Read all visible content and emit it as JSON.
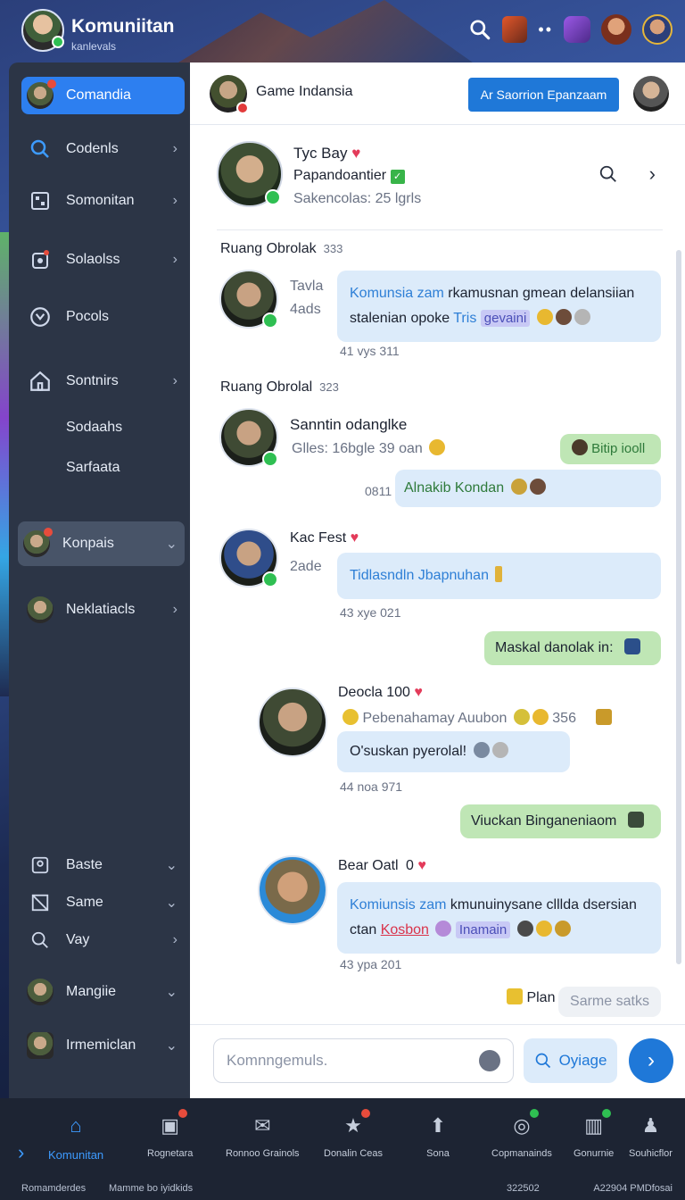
{
  "top": {
    "title": "Komuniitan",
    "subtitle": "kanlevals"
  },
  "sidebar": {
    "items": [
      {
        "label": "Comandia"
      },
      {
        "label": "Codenls"
      },
      {
        "label": "Somonitan"
      },
      {
        "label": "Solaolss"
      },
      {
        "label": "Pocols"
      },
      {
        "label": "Sontnirs"
      },
      {
        "label": "Sodaahs"
      },
      {
        "label": "Sarfaata"
      },
      {
        "label": "Konpais"
      },
      {
        "label": "Neklatiacls"
      },
      {
        "label": "Baste"
      },
      {
        "label": "Same"
      },
      {
        "label": "Vay"
      },
      {
        "label": "Mangiie"
      },
      {
        "label": "Irmemiclan"
      }
    ]
  },
  "header": {
    "title": "Game Indansia",
    "button": "Ar Saorrion Epanzaam"
  },
  "profile": {
    "name": "Tyc Bay",
    "line2": "Papandoantier",
    "line3": "Sakencolas: 25 lgrls"
  },
  "feed": {
    "section1": {
      "title": "Ruang Obrolak",
      "count": "333"
    },
    "msg1": {
      "side_top": "Tavla",
      "side_bottom": "4ads",
      "text_blue": "Komunsia zam",
      "text_rest": " rkamusnan gmean delansiian stalenian opoke ",
      "text_tris": "Tris",
      "tag": "gevaini",
      "time": "41 vys 311"
    },
    "section2": {
      "title": "Ruang Obrolal",
      "count": "323"
    },
    "msg2": {
      "name": "Sanntin odanglke",
      "line2": "Glles: 16bgle 39 oan",
      "green_chip": "Bitip iooll",
      "time_label": "0811",
      "bubble": "Alnakib Kondan"
    },
    "msg3": {
      "name": "Kac Fest",
      "sub": "2ade",
      "bubble": "Tidlasndln Jbapnuhan",
      "time": "43 xye 021",
      "reply": "Maskal danolak in:"
    },
    "msg4": {
      "name": "Deocla 100",
      "line2": "Pebenahamay Auubon",
      "count": "356",
      "bubble": "O'suskan pyerolal!",
      "time": "44 noa 971",
      "reply": "Viuckan Binganeniaom"
    },
    "msg5": {
      "name": "Bear Oatl",
      "badge": "0",
      "text_blue": "Komiunsis zam",
      "text_rest": " kmunuinysane clllda dsersian ctan ",
      "text_red": "Kosbon",
      "tag": "Inamain",
      "time": "43 ypa 201",
      "plan": "Plan",
      "chip": "Sarme satks"
    }
  },
  "composer": {
    "placeholder": "Komnngemuls.",
    "button": "Oyiage"
  },
  "bottom_nav": [
    {
      "label": "Komunitan"
    },
    {
      "label": "Rognetara"
    },
    {
      "label": "Ronnoo Grainols"
    },
    {
      "label": "Donalin Ceas"
    },
    {
      "label": "Sona"
    },
    {
      "label": "Copmanainds"
    },
    {
      "label": "Gonurnie"
    },
    {
      "label": "Souhicflor"
    }
  ],
  "status": {
    "left": "Romamderdes",
    "mid": "Mamme bo iyidkids",
    "right1": "322502",
    "right2": "A22904 PMDfosai"
  },
  "colors": {
    "accent": "#1f78d8",
    "sidebar": "#2c3546",
    "active": "#2d7ff0",
    "bubble_blue": "#dcebfa",
    "bubble_green": "#bfe6b5"
  }
}
